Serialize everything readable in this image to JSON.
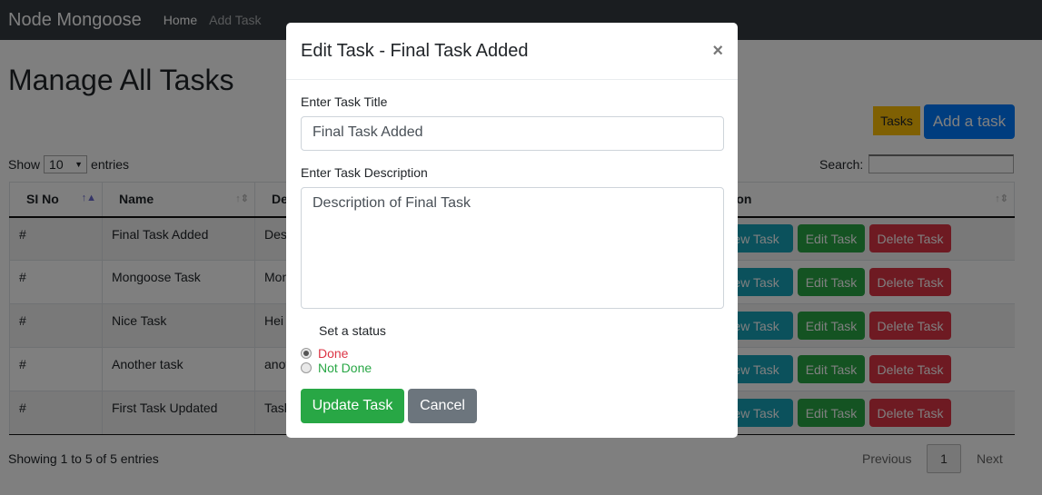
{
  "navbar": {
    "brand": "Node Mongoose",
    "links": [
      "Home",
      "Add Task"
    ]
  },
  "page": {
    "title": "Manage All Tasks",
    "tasks_button": "Tasks",
    "add_button": "Add a task"
  },
  "table_controls": {
    "show": "Show",
    "page_size": "10",
    "entries": "entries",
    "search_label": "Search:",
    "search_value": ""
  },
  "table": {
    "headers": [
      "SI No",
      "Name",
      "De",
      "ction"
    ],
    "rows": [
      {
        "sl": "#",
        "name": "Final Task Added",
        "desc": "Des"
      },
      {
        "sl": "#",
        "name": "Mongoose Task",
        "desc": "Mon"
      },
      {
        "sl": "#",
        "name": "Nice Task",
        "desc": "Hei"
      },
      {
        "sl": "#",
        "name": "Another task",
        "desc": "anot"
      },
      {
        "sl": "#",
        "name": "First Task Updated",
        "desc": "Task"
      }
    ],
    "actions": [
      "View Task",
      "Edit Task",
      "Delete Task"
    ]
  },
  "footer": {
    "info": "Showing 1 to 5 of 5 entries",
    "previous": "Previous",
    "page": "1",
    "next": "Next"
  },
  "modal": {
    "title": "Edit Task - Final Task Added",
    "close": "×",
    "title_label": "Enter Task Title",
    "title_value": "Final Task Added",
    "desc_label": "Enter Task Description",
    "desc_value": "Description of Final Task",
    "status_label": "Set a status",
    "status_options": [
      "Done",
      "Not Done"
    ],
    "selected_status": "Done",
    "update": "Update Task",
    "cancel": "Cancel"
  },
  "colors": {
    "primary": "#007bff",
    "success": "#28a745",
    "danger": "#dc3545",
    "info": "#17a2b8",
    "warning": "#ffc107",
    "secondary": "#6c757d",
    "green_btn": "#28a745"
  }
}
